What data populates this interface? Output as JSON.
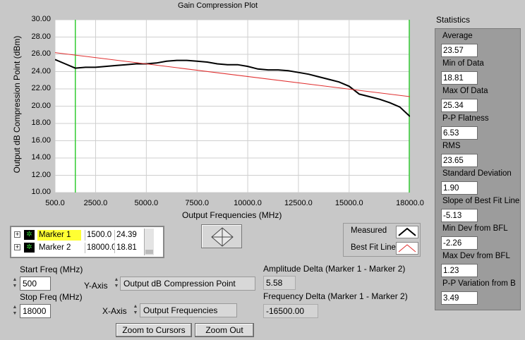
{
  "plot": {
    "title": "Gain Compression Plot",
    "ylabel": "Output dB Compression Point (dBm)",
    "xlabel": "Output Frequencies (MHz)",
    "yticks": [
      "30.00",
      "28.00",
      "26.00",
      "24.00",
      "22.00",
      "20.00",
      "18.00",
      "16.00",
      "14.00",
      "12.00",
      "10.00"
    ],
    "xticks": [
      "500.0",
      "2500.0",
      "5000.0",
      "7500.0",
      "10000.0",
      "12500.0",
      "15000.0",
      "18000.0"
    ]
  },
  "chart_data": {
    "type": "line",
    "xlim": [
      500,
      18000
    ],
    "ylim": [
      10,
      30
    ],
    "series": [
      {
        "name": "Measured",
        "color": "#000000",
        "x": [
          500,
          1000,
          1500,
          2000,
          2500,
          3000,
          3500,
          4000,
          4500,
          5000,
          5500,
          6000,
          6500,
          7000,
          7500,
          8000,
          8500,
          9000,
          9500,
          10000,
          10500,
          11000,
          11500,
          12000,
          12500,
          13000,
          13500,
          14000,
          14500,
          15000,
          15500,
          16000,
          16500,
          17000,
          17500,
          18000
        ],
        "y": [
          25.4,
          24.9,
          24.4,
          24.5,
          24.5,
          24.6,
          24.7,
          24.8,
          24.9,
          24.9,
          25.0,
          25.2,
          25.3,
          25.3,
          25.2,
          25.1,
          24.9,
          24.8,
          24.8,
          24.6,
          24.3,
          24.2,
          24.2,
          24.1,
          23.9,
          23.7,
          23.4,
          23.1,
          22.8,
          22.3,
          21.4,
          21.1,
          20.8,
          20.4,
          19.9,
          18.81
        ]
      },
      {
        "name": "Best Fit Line",
        "color": "#e03030",
        "x": [
          500,
          18000
        ],
        "y": [
          26.2,
          21.1
        ]
      }
    ],
    "cursors": [
      {
        "x": 1500,
        "color": "#33cc33"
      },
      {
        "x": 18000,
        "color": "#33cc33"
      }
    ]
  },
  "markers": [
    {
      "name": "Marker 1",
      "x": "1500.0",
      "y": "24.39",
      "highlight": true
    },
    {
      "name": "Marker 2",
      "x": "18000.0",
      "y": "18.81",
      "highlight": false
    }
  ],
  "legend": {
    "measured": "Measured",
    "bestfit": "Best Fit Line"
  },
  "stats": {
    "heading": "Statistics",
    "items": [
      {
        "label": "Average",
        "value": "23.57"
      },
      {
        "label": "Min of Data",
        "value": "18.81"
      },
      {
        "label": "Max Of Data",
        "value": "25.34"
      },
      {
        "label": "P-P Flatness",
        "value": "6.53"
      },
      {
        "label": "RMS",
        "value": "23.65"
      },
      {
        "label": "Standard Deviation",
        "value": "1.90"
      },
      {
        "label": "Slope of Best Fit Line",
        "value": "-5.13"
      },
      {
        "label": "Min Dev from BFL",
        "value": "-2.26"
      },
      {
        "label": "Max Dev from BFL",
        "value": "1.23"
      },
      {
        "label": "P-P Variation from B",
        "value": "3.49"
      }
    ]
  },
  "controls": {
    "start_label": "Start Freq (MHz)",
    "start_value": "500",
    "stop_label": "Stop Freq (MHz)",
    "stop_value": "18000",
    "yaxis_label": "Y-Axis",
    "yaxis_value": "Output dB Compression Point",
    "xaxis_label": "X-Axis",
    "xaxis_value": "Output Frequencies",
    "amp_label": "Amplitude Delta (Marker 1 - Marker 2)",
    "amp_value": "5.58",
    "freq_label": "Frequency Delta (Marker 1 - Marker 2)",
    "freq_value": "-16500.00",
    "zoom_cursors": "Zoom to Cursors",
    "zoom_out": "Zoom Out"
  }
}
